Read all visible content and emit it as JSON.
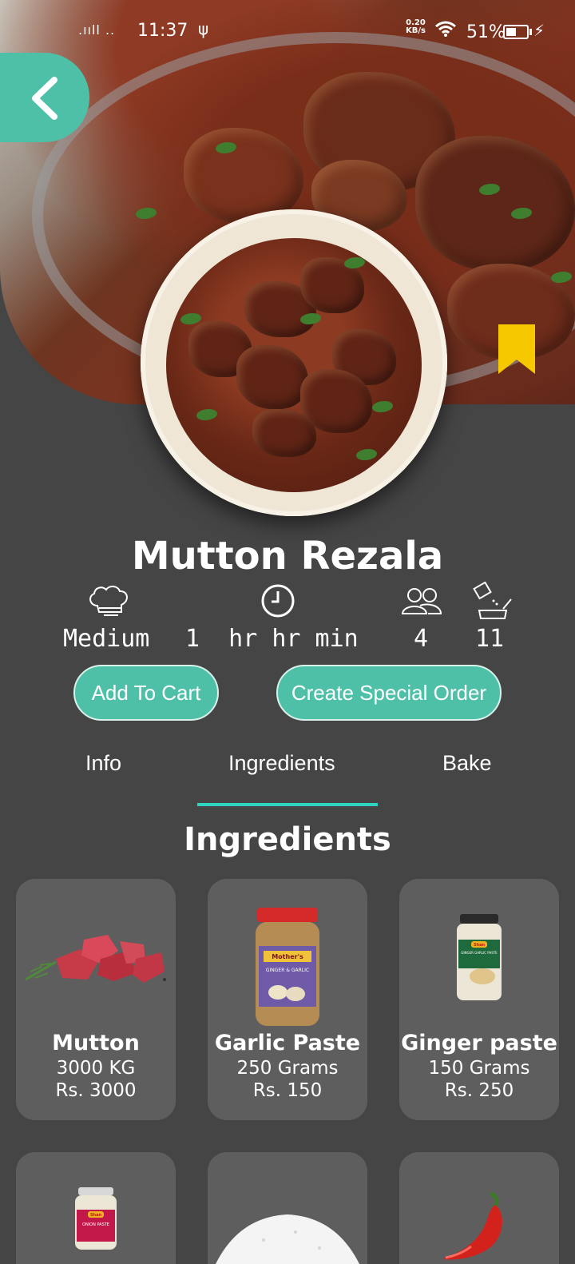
{
  "status_bar": {
    "time": "11:37",
    "signal": ".ııll ..",
    "usb": "ψ",
    "net_speed_value": "0.20",
    "net_speed_unit": "KB/s",
    "battery": "51%",
    "battery_level": 0.51
  },
  "recipe": {
    "title": "Mutton Rezala",
    "difficulty": "Medium",
    "time": "1  hr hr min",
    "servings": "4",
    "ingredients_count": "11"
  },
  "actions": {
    "add_to_cart": "Add To Cart",
    "special_order": "Create Special Order"
  },
  "tabs": [
    {
      "label": "Info"
    },
    {
      "label": "Ingredients",
      "active": true
    },
    {
      "label": "Bake"
    }
  ],
  "section_title": "Ingredients",
  "ingredients": [
    {
      "name": "Mutton",
      "qty": "3000 KG",
      "price": "Rs. 3000"
    },
    {
      "name": "Garlic Paste",
      "qty": "250 Grams",
      "price": "Rs. 150"
    },
    {
      "name": "Ginger paste",
      "qty": "150 Grams",
      "price": "Rs. 250"
    }
  ],
  "product_labels": {
    "garlic_brand": "Mother's",
    "garlic_label": "GINGER & GARLIC",
    "ginger_brand": "Shan",
    "ginger_label": "GINGER GARLIC PASTE",
    "onion_brand": "Shan",
    "onion_label": "ONION PASTE"
  },
  "colors": {
    "accent": "#4fc0a8",
    "tab_indicator": "#2ed3c1",
    "bookmark": "#f6c800",
    "background": "#454545",
    "card": "#5e5e5e"
  }
}
